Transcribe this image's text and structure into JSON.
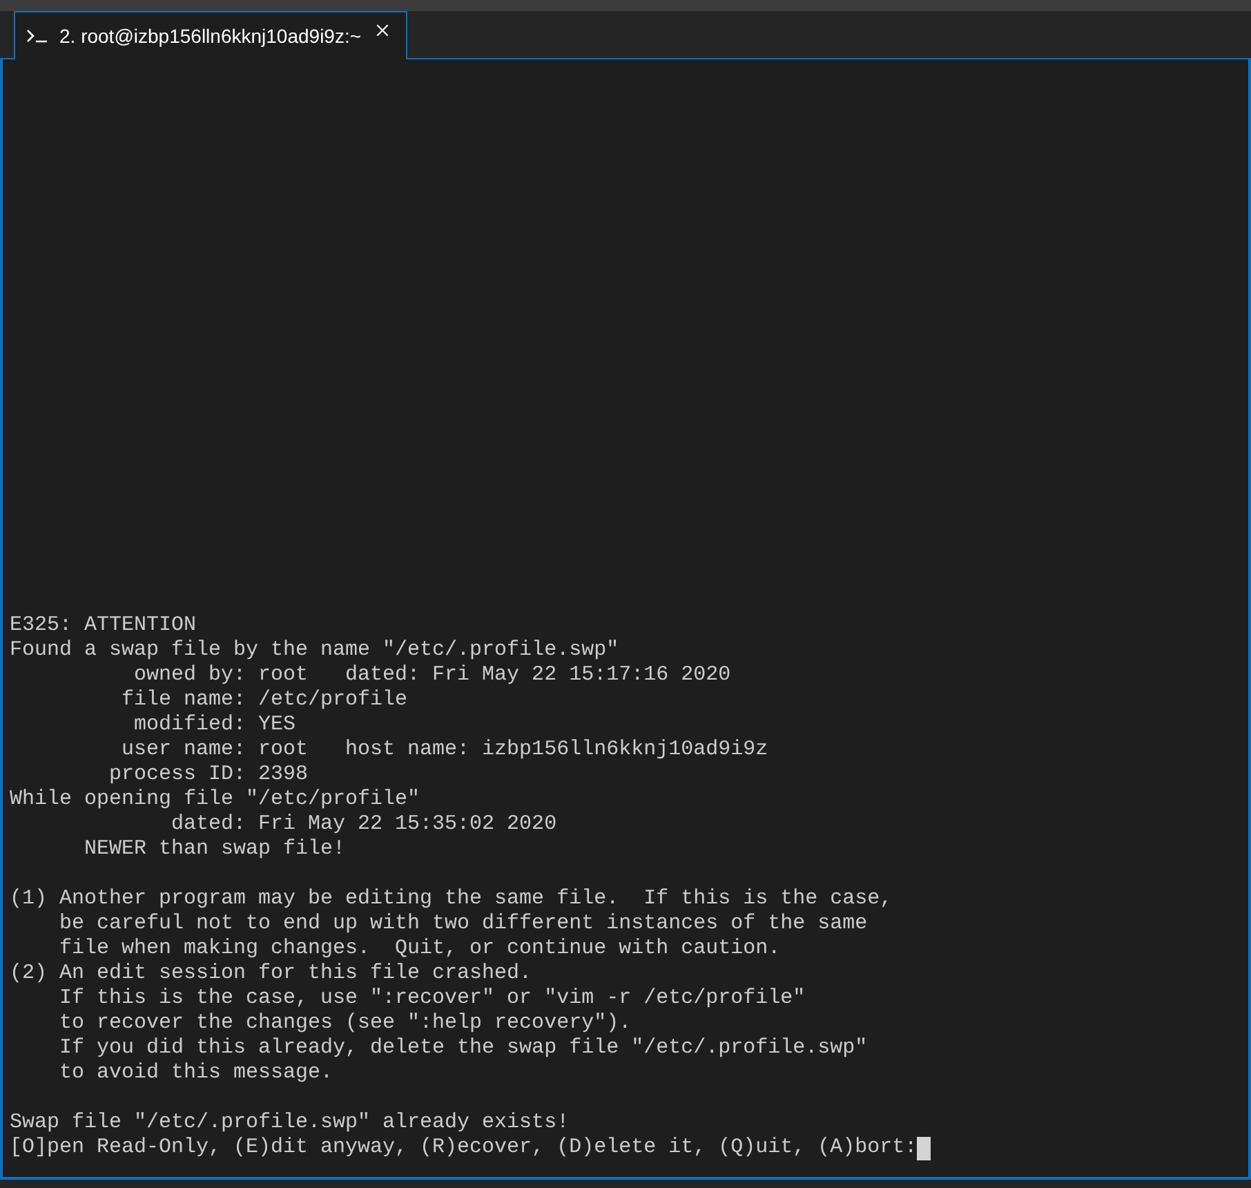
{
  "tabs": [
    {
      "label": "2. root@izbp156lln6kknj10ad9i9z:~",
      "selected": true
    }
  ],
  "terminal": {
    "blocks": [
      {
        "lines": [
          "E325: ATTENTION",
          "Found a swap file by the name \"/etc/.profile.swp\"",
          "          owned by: root   dated: Fri May 22 15:17:16 2020",
          "         file name: /etc/profile",
          "          modified: YES",
          "         user name: root   host name: izbp156lln6kknj10ad9i9z",
          "        process ID: 2398",
          "While opening file \"/etc/profile\"",
          "             dated: Fri May 22 15:35:02 2020",
          "      NEWER than swap file!"
        ]
      },
      {
        "lines": [
          "(1) Another program may be editing the same file.  If this is the case,",
          "    be careful not to end up with two different instances of the same",
          "    file when making changes.  Quit, or continue with caution.",
          "(2) An edit session for this file crashed.",
          "    If this is the case, use \":recover\" or \"vim -r /etc/profile\"",
          "    to recover the changes (see \":help recovery\").",
          "    If you did this already, delete the swap file \"/etc/.profile.swp\"",
          "    to avoid this message."
        ]
      },
      {
        "lines": [
          "Swap file \"/etc/.profile.swp\" already exists!"
        ],
        "prompt": "[O]pen Read-Only, (E)dit anyway, (R)ecover, (D)elete it, (Q)uit, (A)bort:"
      }
    ]
  }
}
